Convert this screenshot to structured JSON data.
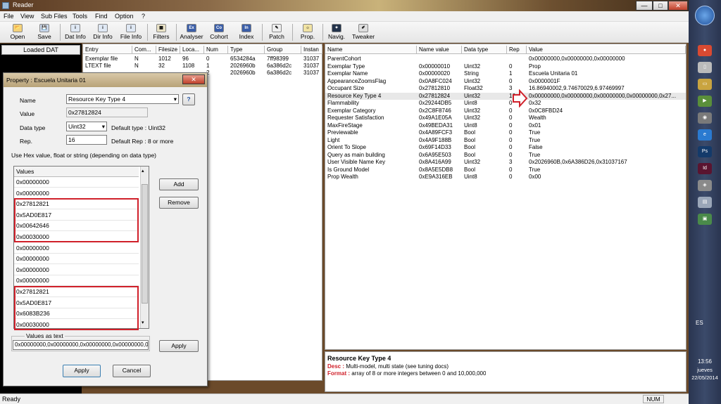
{
  "window": {
    "title": "Reader",
    "min_label": "—",
    "max_label": "□",
    "close_label": "✕"
  },
  "menu": [
    "File",
    "View",
    "Sub Files",
    "Tools",
    "Find",
    "Option",
    "?"
  ],
  "toolbar": [
    {
      "label": "Open",
      "icon": "folder-icon",
      "glyph": "📂"
    },
    {
      "label": "Save",
      "icon": "save-icon",
      "glyph": "💾"
    },
    {
      "label": "Dat Info",
      "icon": "dat-info-icon",
      "glyph": "i"
    },
    {
      "label": "Dir Info",
      "icon": "dir-info-icon",
      "glyph": "i"
    },
    {
      "label": "File Info",
      "icon": "file-info-icon",
      "glyph": "i"
    },
    {
      "label": "Filters",
      "icon": "filter-icon",
      "glyph": "▦"
    },
    {
      "label": "Analyser",
      "icon": "analyser-icon",
      "glyph": "Ex"
    },
    {
      "label": "Cohort",
      "icon": "cohort-icon",
      "glyph": "Co"
    },
    {
      "label": "Index",
      "icon": "index-icon",
      "glyph": "In"
    },
    {
      "label": "Patch",
      "icon": "patch-icon",
      "glyph": "✎"
    },
    {
      "label": "Prop.",
      "icon": "prop-icon",
      "glyph": "☼"
    },
    {
      "label": "Navig.",
      "icon": "navig-icon",
      "glyph": "✦"
    },
    {
      "label": "Tweaker",
      "icon": "tweaker-icon",
      "glyph": "✐"
    }
  ],
  "left_pane": {
    "header": "Loaded DAT"
  },
  "entries": {
    "columns": [
      "Entry",
      "Com...",
      "Filesize",
      "Loca...",
      "Num",
      "Type",
      "Group",
      "Instan"
    ],
    "rows": [
      [
        "Exemplar file",
        "N",
        "1012",
        "96",
        "0",
        "6534284a",
        "7ff98399",
        "31037"
      ],
      [
        "LTEXT file",
        "N",
        "32",
        "1108",
        "1",
        "2026960b",
        "6a386d2c",
        "31037"
      ],
      [
        "",
        "",
        "",
        "",
        "2",
        "2026960b",
        "6a386d2c",
        "31037"
      ]
    ]
  },
  "properties": {
    "columns": [
      "Name",
      "Name value",
      "Data type",
      "Rep",
      "Value"
    ],
    "rows": [
      [
        "ParentCohort",
        "",
        "",
        "",
        "0x00000000,0x00000000,0x00000000"
      ],
      [
        "Exemplar Type",
        "0x00000010",
        "Uint32",
        "0",
        "Prop"
      ],
      [
        "Exemplar Name",
        "0x00000020",
        "String",
        "1",
        "Escuela Unitaria 01"
      ],
      [
        "AppearanceZoomsFlag",
        "0x0A8FC024",
        "Uint32",
        "0",
        "0x0000001F"
      ],
      [
        "Occupant Size",
        "0x27812810",
        "Float32",
        "3",
        "16.86940002,9.74670029,6.97469997"
      ],
      [
        "Resource Key Type 4",
        "0x27812824",
        "Uint32",
        "16",
        "0x00000000,0x00000000,0x00000000,0x00000000,0x27..."
      ],
      [
        "Flammability",
        "0x29244DB5",
        "Uint8",
        "0",
        "0x32"
      ],
      [
        "Exemplar Category",
        "0x2C8F8746",
        "Uint32",
        "0",
        "0x0C8FBD24"
      ],
      [
        "Requester Satisfaction",
        "0x49A1E05A",
        "Uint32",
        "0",
        "Wealth"
      ],
      [
        "MaxFireStage",
        "0x49BEDA31",
        "Uint8",
        "0",
        "0x01"
      ],
      [
        "Previewable",
        "0x4A89FCF3",
        "Bool",
        "0",
        "True"
      ],
      [
        "Light",
        "0x4A9F188B",
        "Bool",
        "0",
        "True"
      ],
      [
        "Orient To Slope",
        "0x69F14D33",
        "Bool",
        "0",
        "False"
      ],
      [
        "Query as main building",
        "0x6A95E503",
        "Bool",
        "0",
        "True"
      ],
      [
        "User Visible Name Key",
        "0x8A416A99",
        "Uint32",
        "3",
        "0x2026960B,0x6A386D26,0x31037167"
      ],
      [
        "Is Ground Model",
        "0x8A5E5DB8",
        "Bool",
        "0",
        "True"
      ],
      [
        "Prop Wealth",
        "0xE9A316EB",
        "Uint8",
        "0",
        "0x00"
      ]
    ]
  },
  "description": {
    "title": "Resource Key Type 4",
    "desc_label": "Desc :",
    "desc_text": " Multi-model, multi state (see tuning docs)",
    "format_label": "Format :",
    "format_text": " array of 8 or more integers between 0 and 10,000,000"
  },
  "dialog": {
    "title": "Property : Escuela Unitaria 01",
    "name_label": "Name",
    "name_value": "Resource Key Type 4",
    "help_label": "?",
    "value_label": "Value",
    "value_value": "0x27812824",
    "datatype_label": "Data type",
    "datatype_value": "Uint32",
    "default_type": "Default type :  Uint32",
    "rep_label": "Rep.",
    "rep_value": "16",
    "default_rep": "Default Rep :  8  or more",
    "hint": "Use Hex value, float or string (depending on data type)",
    "values_header": "Values",
    "values": [
      "0x00000000",
      "0x00000000",
      "0x27812821",
      "0x5AD0E817",
      "0x00642646",
      "0x00030000",
      "0x00000000",
      "0x00000000",
      "0x00000000",
      "0x00000000",
      "0x27812821",
      "0x5AD0E817",
      "0x6083B236",
      "0x00030000"
    ],
    "add_label": "Add",
    "remove_label": "Remove",
    "values_as_text_label": "Values as text",
    "values_as_text": "0x00000000,0x00000000,0x00000000,0x00000000,0",
    "apply_small_label": "Apply",
    "apply_label": "Apply",
    "cancel_label": "Cancel"
  },
  "status": {
    "text": "Ready",
    "num": "NUM"
  },
  "taskbar": {
    "lang": "ES",
    "time": "13:56",
    "day": "jueves",
    "date": "22/05/2014"
  },
  "colors": {
    "accent_red": "#d0202a",
    "taskbar": "#2a3550"
  }
}
